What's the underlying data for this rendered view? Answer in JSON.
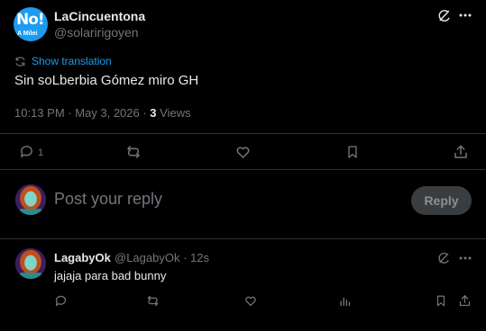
{
  "tweet": {
    "author_name": "LaCincuentona",
    "author_handle": "@solaririgoyen",
    "avatar_text": "No!",
    "avatar_subtext": "A Milei",
    "translate_label": "Show translation",
    "text": "Sin soLberbia Gómez miro GH",
    "timestamp": "10:13 PM · May 3, 2026 · ",
    "views_count": "3",
    "views_label": " Views",
    "actions": {
      "reply_count": "1",
      "retweet_count": "",
      "like_count": ""
    }
  },
  "composer": {
    "placeholder": "Post your reply",
    "reply_button": "Reply"
  },
  "reply": {
    "author_name": "LagabyOk",
    "author_handle": "@LagabyOk · 12s",
    "text": "jajaja para bad bunny"
  },
  "colors": {
    "background": "#000000",
    "text": "#e7e9ea",
    "muted": "#71767b",
    "accent": "#1d9bf0",
    "divider": "#2f3336"
  },
  "icons": [
    "grok-icon",
    "more-icon",
    "translate-icon",
    "reply-icon",
    "retweet-icon",
    "like-icon",
    "bookmark-icon",
    "share-icon",
    "views-icon"
  ]
}
